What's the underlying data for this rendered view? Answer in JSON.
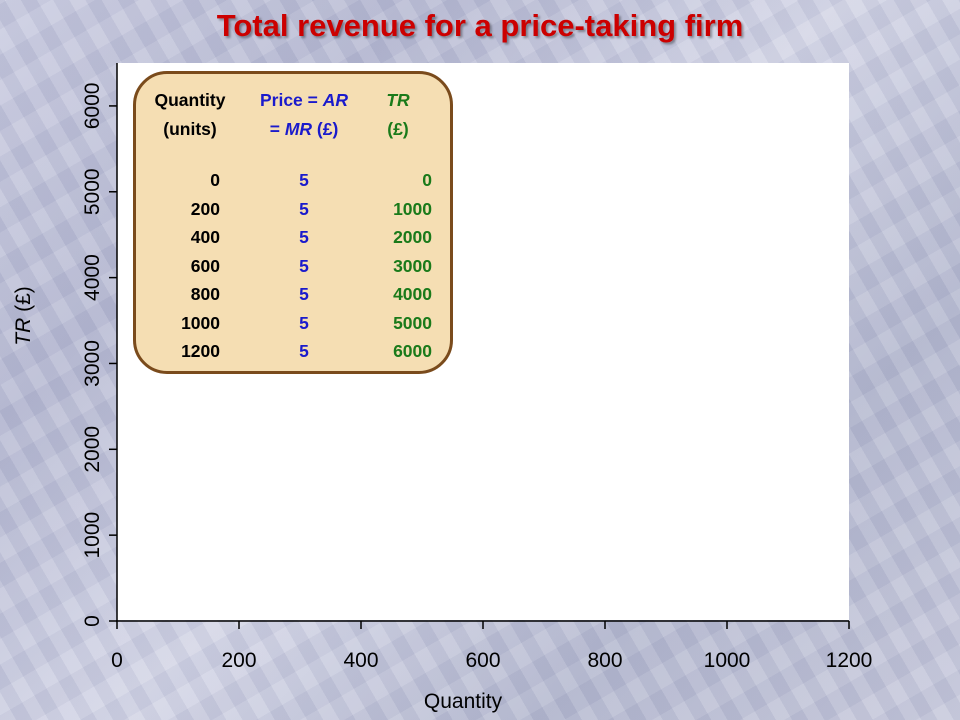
{
  "slide": {
    "title": "Total revenue for a price-taking firm"
  },
  "table": {
    "headers": {
      "quantity": [
        "Quantity",
        "(units)"
      ],
      "price": [
        "Price = AR",
        "= MR (£)"
      ],
      "tr": [
        "TR",
        "(£)"
      ]
    },
    "rows": [
      {
        "quantity": "0",
        "price": "5",
        "tr": "0"
      },
      {
        "quantity": "200",
        "price": "5",
        "tr": "1000"
      },
      {
        "quantity": "400",
        "price": "5",
        "tr": "2000"
      },
      {
        "quantity": "600",
        "price": "5",
        "tr": "3000"
      },
      {
        "quantity": "800",
        "price": "5",
        "tr": "4000"
      },
      {
        "quantity": "1000",
        "price": "5",
        "tr": "5000"
      },
      {
        "quantity": "1200",
        "price": "5",
        "tr": "6000"
      }
    ]
  },
  "chart_data": {
    "type": "line",
    "title": "Total revenue for a price-taking firm",
    "xlabel": "Quantity",
    "ylabel": "TR (£)",
    "xlim": [
      0,
      1200
    ],
    "ylim": [
      0,
      6500
    ],
    "x_ticks": [
      0,
      200,
      400,
      600,
      800,
      1000,
      1200
    ],
    "y_ticks": [
      0,
      1000,
      2000,
      3000,
      4000,
      5000,
      6000
    ],
    "grid": false,
    "series": []
  },
  "colors": {
    "title": "#cc0000",
    "quantity_text": "#000000",
    "price_text": "#1a1acc",
    "tr_text": "#1a7a1a",
    "table_fill": "#f5deb3",
    "table_border": "#7a4b1c"
  }
}
